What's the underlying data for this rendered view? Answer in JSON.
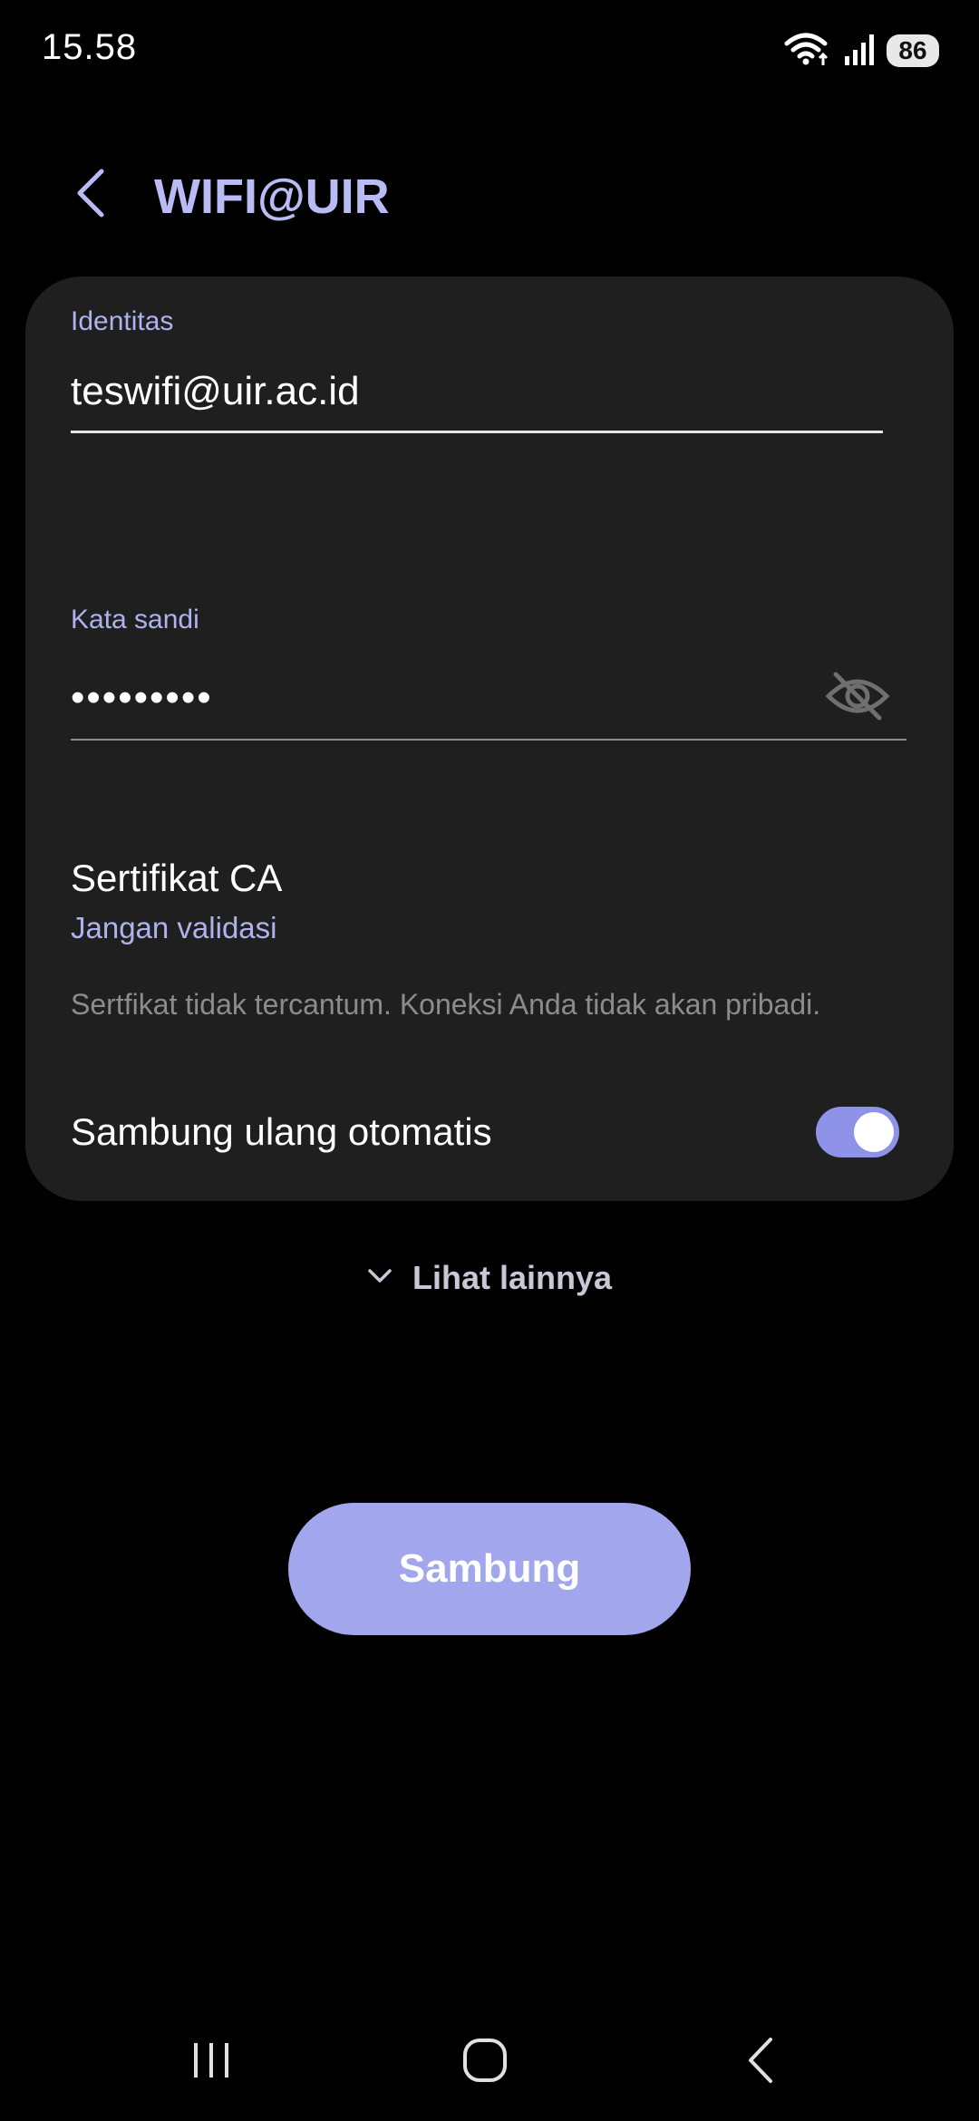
{
  "status_bar": {
    "time": "15.58",
    "battery": "86"
  },
  "header": {
    "title": "WIFI@UIR"
  },
  "form": {
    "identity_label": "Identitas",
    "identity_value": "teswifi@uir.ac.id",
    "password_label": "Kata sandi",
    "password_value": "•••••••••"
  },
  "certificate": {
    "title": "Sertifikat CA",
    "value": "Jangan validasi",
    "note": "Sertfikat tidak tercantum. Koneksi Anda tidak akan pribadi."
  },
  "auto_reconnect": {
    "label": "Sambung ulang otomatis",
    "enabled": true
  },
  "see_more": {
    "label": "Lihat lainnya"
  },
  "connect_button": {
    "label": "Sambung"
  },
  "colors": {
    "accent": "#b9bcf4",
    "button": "#a2a6ec",
    "card": "#1f1f1f",
    "background": "#000000"
  },
  "icons": {
    "back": "chevron-left-icon",
    "visibility": "eye-off-icon",
    "expand": "chevron-down-icon",
    "wifi": "wifi-icon",
    "signal": "signal-icon",
    "nav_recents": "recents-icon",
    "nav_home": "home-icon",
    "nav_back": "back-icon"
  }
}
